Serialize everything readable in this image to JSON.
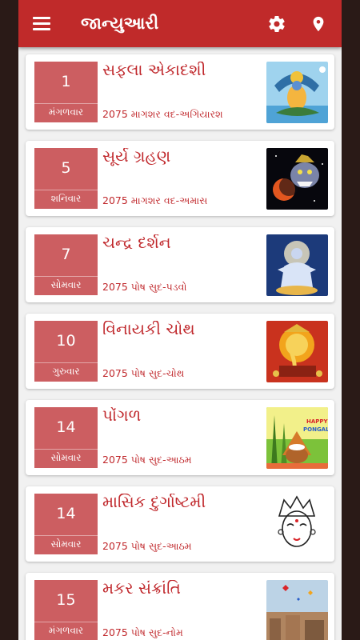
{
  "header": {
    "title": "જાન્યુઆરી",
    "menu_icon": "hamburger-menu-icon",
    "settings_icon": "gear-icon",
    "location_icon": "location-pin-icon"
  },
  "colors": {
    "appbar": "#c02a2a",
    "date_box": "#cc5e61",
    "accent_text": "#c0282c"
  },
  "events": [
    {
      "day": "1",
      "weekday": "મંગળવાર",
      "name": "સફલા એકાદશી",
      "subtitle": "2075 માગશર વદ-અગિયારશ",
      "image": "vishnu-on-sheshnag-image"
    },
    {
      "day": "5",
      "weekday": "શનિવાર",
      "name": "સૂર્ય ગ્રહણ",
      "subtitle": "2075 માગશર વદ-અમાસ",
      "image": "rahu-eclipse-image"
    },
    {
      "day": "7",
      "weekday": "સોમવાર",
      "name": "ચન્દ્ર દર્શન",
      "subtitle": "2075 પોષ સુદ-પડવો",
      "image": "chandra-dev-image"
    },
    {
      "day": "10",
      "weekday": "ગુરુવાર",
      "name": "વિનાયકી ચોથ",
      "subtitle": "2075 પોષ સુદ-ચોથ",
      "image": "ganesha-image"
    },
    {
      "day": "14",
      "weekday": "સોમવાર",
      "name": "પોંગળ",
      "subtitle": "2075 પોષ સુદ-આઠમ",
      "image": "happy-pongal-image",
      "image_text_1": "HAPPY",
      "image_text_2": "PONGAL"
    },
    {
      "day": "14",
      "weekday": "સોમવાર",
      "name": "માસિક દુર્ગાષ્ટમી",
      "subtitle": "2075 પોષ સુદ-આઠમ",
      "image": "durga-face-image"
    },
    {
      "day": "15",
      "weekday": "મંગળવાર",
      "name": "મકર સંક્રાંતિ",
      "subtitle": "2075 પોષ સુદ-નોમ",
      "image": "kite-festival-image"
    }
  ]
}
